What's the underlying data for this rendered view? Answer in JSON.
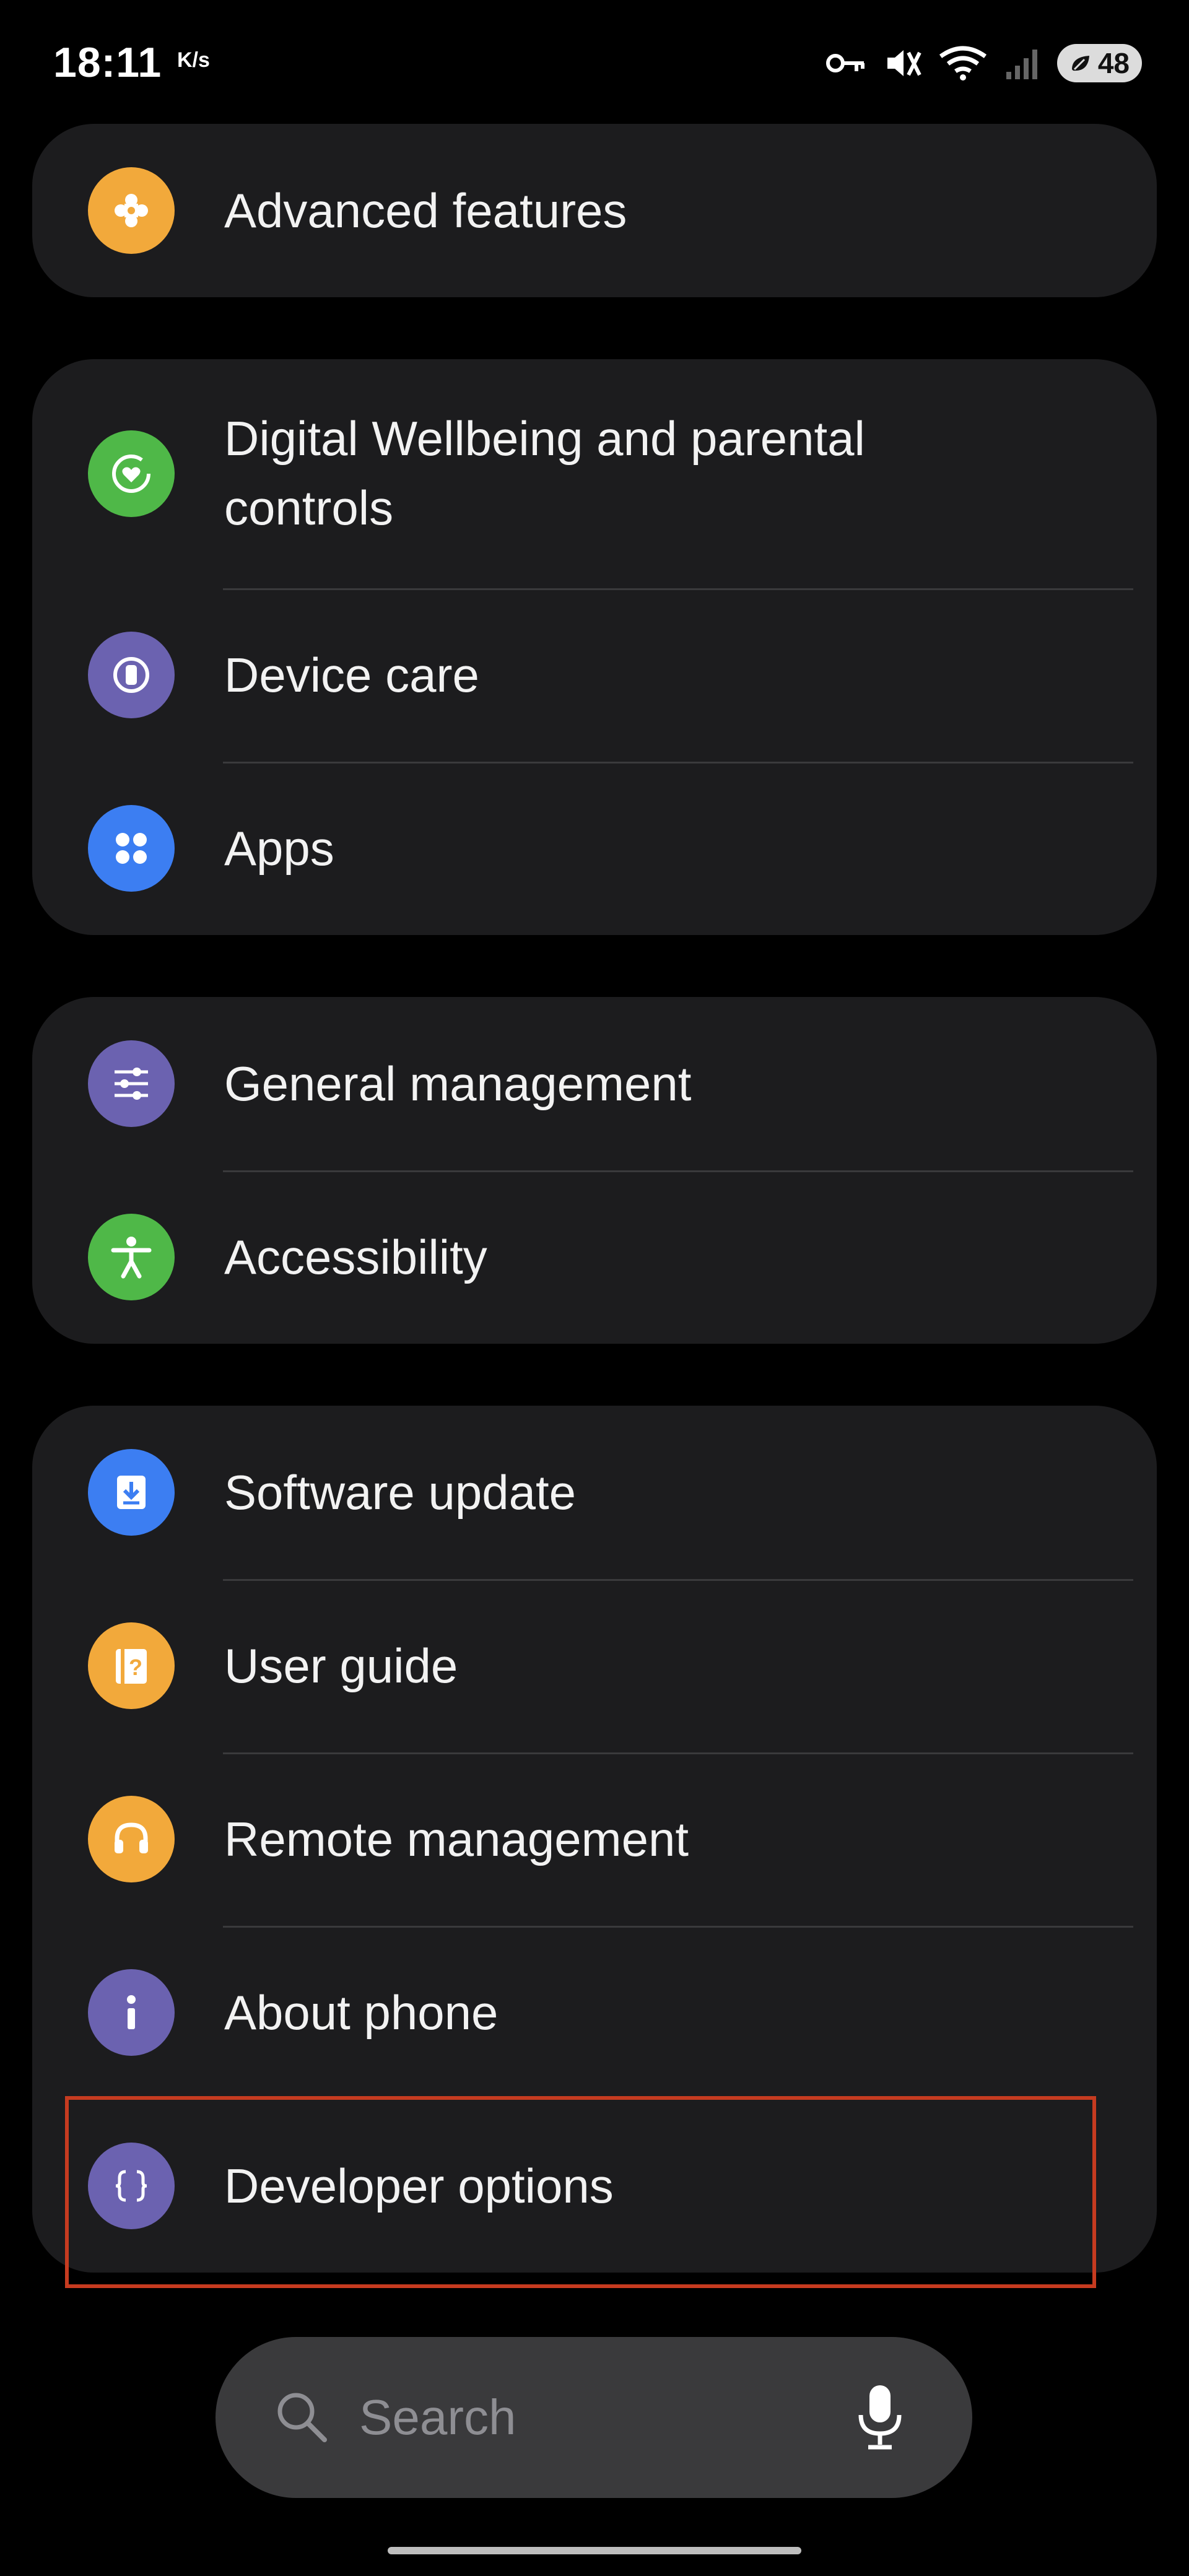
{
  "status_bar": {
    "time": "18:11",
    "net_speed": "K/s",
    "battery": "48",
    "icons": [
      "key-icon",
      "mute-icon",
      "wifi-icon",
      "signal-icon",
      "battery-icon"
    ]
  },
  "groups": [
    {
      "items": [
        {
          "label": "Advanced features",
          "icon": "puzzle-icon",
          "color": "#f2a93b"
        }
      ]
    },
    {
      "items": [
        {
          "label": "Digital Wellbeing and parental controls",
          "icon": "wellbeing-icon",
          "color": "#4fb848"
        },
        {
          "label": "Device care",
          "icon": "device-care-icon",
          "color": "#6b62b0"
        },
        {
          "label": "Apps",
          "icon": "apps-icon",
          "color": "#3c7ef2"
        }
      ]
    },
    {
      "items": [
        {
          "label": "General management",
          "icon": "sliders-icon",
          "color": "#6b62b0"
        },
        {
          "label": "Accessibility",
          "icon": "accessibility-icon",
          "color": "#4fb848"
        }
      ]
    },
    {
      "items": [
        {
          "label": "Software update",
          "icon": "download-icon",
          "color": "#3c7ef2"
        },
        {
          "label": "User guide",
          "icon": "user-guide-icon",
          "color": "#f2a93b"
        },
        {
          "label": "Remote management",
          "icon": "headset-icon",
          "color": "#f2a93b"
        },
        {
          "label": "About phone",
          "icon": "info-icon",
          "color": "#6b62b0"
        },
        {
          "label": "Developer options",
          "icon": "braces-icon",
          "color": "#6b62b0"
        }
      ]
    }
  ],
  "search": {
    "placeholder": "Search"
  },
  "highlight_color": "#c63b20"
}
